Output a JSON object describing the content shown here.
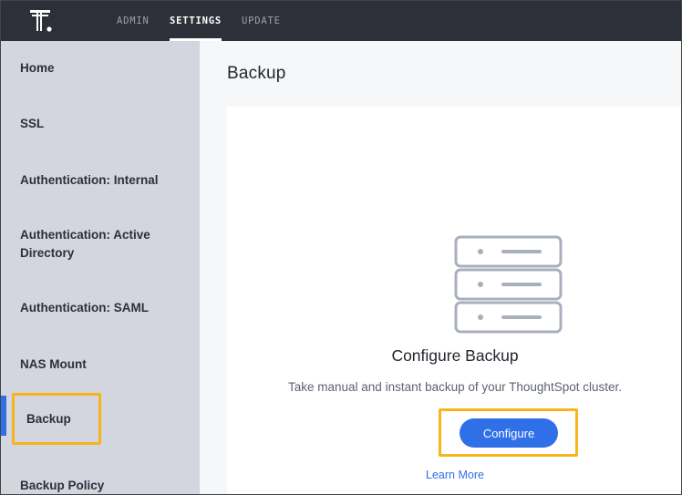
{
  "topbar": {
    "tabs": [
      {
        "label": "ADMIN",
        "active": false
      },
      {
        "label": "SETTINGS",
        "active": true
      },
      {
        "label": "UPDATE",
        "active": false
      }
    ]
  },
  "sidebar": {
    "items": [
      {
        "label": "Home"
      },
      {
        "label": "SSL"
      },
      {
        "label": "Authentication: Internal"
      },
      {
        "label": "Authentication: Active Directory"
      },
      {
        "label": "Authentication: SAML"
      },
      {
        "label": "NAS Mount"
      },
      {
        "label": "Backup",
        "active": true
      },
      {
        "label": "Backup Policy"
      }
    ]
  },
  "main": {
    "title": "Backup",
    "card": {
      "title": "Configure Backup",
      "description": "Take manual and instant backup of your ThoughtSpot cluster.",
      "configure_label": "Configure",
      "learn_more_label": "Learn More"
    }
  },
  "colors": {
    "topbar": "#2d3038",
    "sidebar": "#d3d6de",
    "accent": "#2f6fe8",
    "highlight": "#f5b51b"
  }
}
